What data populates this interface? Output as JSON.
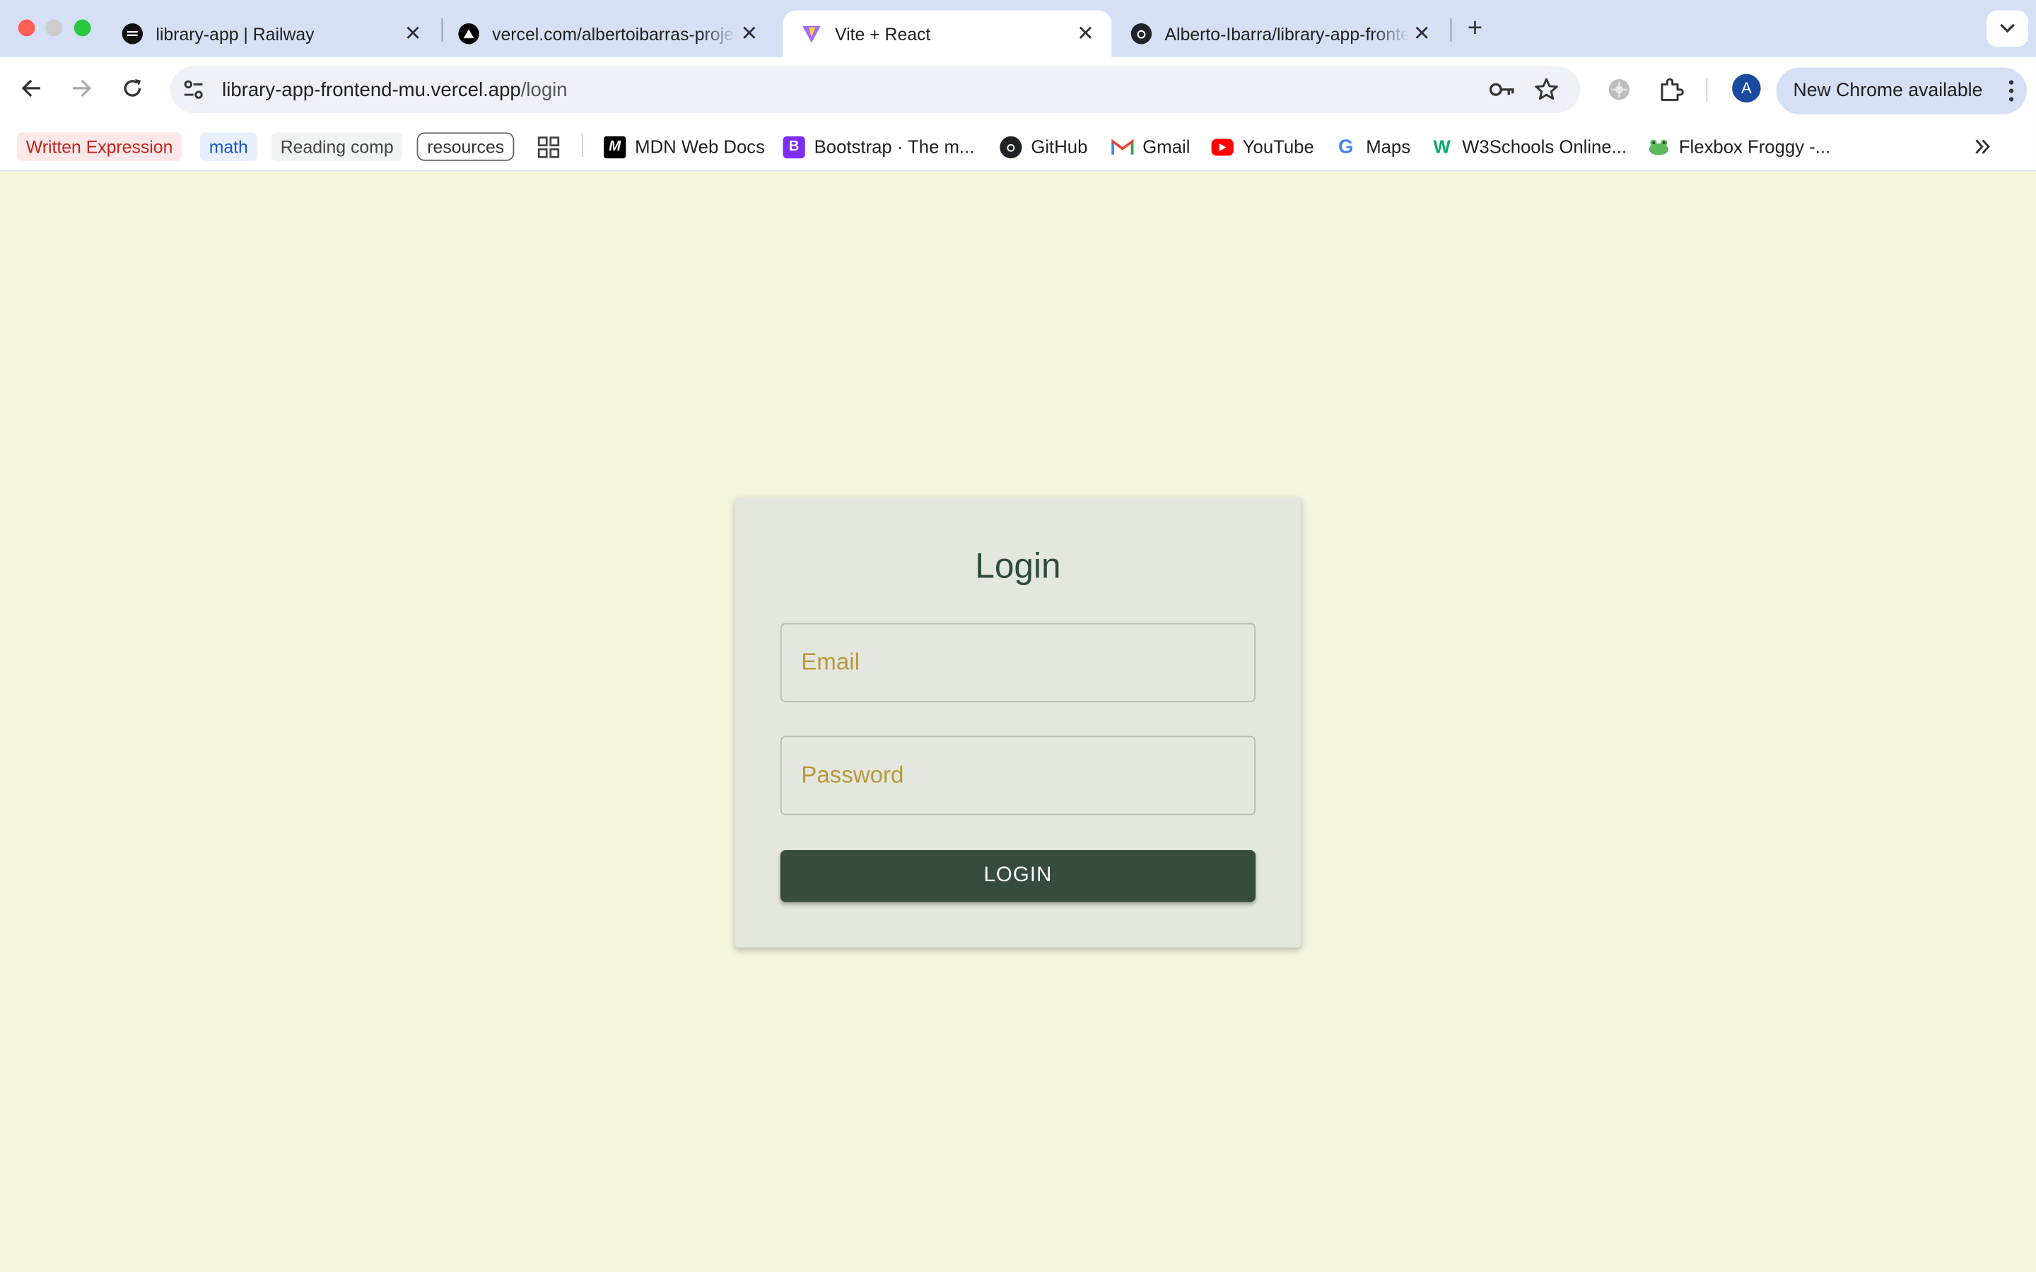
{
  "tabs": [
    {
      "title": "library-app | Railway",
      "icon": "railway-icon"
    },
    {
      "title": "vercel.com/albertoibarras-projects",
      "icon": "vercel-icon"
    },
    {
      "title": "Vite + React",
      "icon": "vite-icon",
      "active": true
    },
    {
      "title": "Alberto-Ibarra/library-app-frontend",
      "icon": "github-icon"
    }
  ],
  "toolbar": {
    "url_host": "library-app-frontend-mu.vercel.app",
    "url_path": "/login",
    "avatar_letter": "A",
    "update_label": "New Chrome available"
  },
  "bookmarks": {
    "chips": [
      "Written Expression",
      "math",
      "Reading comp",
      "resources"
    ],
    "links": [
      {
        "label": "MDN Web Docs",
        "icon": "mdn-icon"
      },
      {
        "label": "Bootstrap · The m...",
        "icon": "bootstrap-icon"
      },
      {
        "label": "GitHub",
        "icon": "github-icon"
      },
      {
        "label": "Gmail",
        "icon": "gmail-icon"
      },
      {
        "label": "YouTube",
        "icon": "youtube-icon"
      },
      {
        "label": "Maps",
        "icon": "google-icon"
      },
      {
        "label": "W3Schools Online...",
        "icon": "w3schools-icon"
      },
      {
        "label": "Flexbox Froggy -...",
        "icon": "frog-icon"
      }
    ]
  },
  "login": {
    "title": "Login",
    "email_placeholder": "Email",
    "password_placeholder": "Password",
    "button_label": "LOGIN"
  },
  "colors": {
    "page_bg": "#f4f4df",
    "card_bg": "#e4e6e0",
    "button_bg": "#354c3f",
    "title_color": "#2d4a3e",
    "placeholder_color": "#b59a3a"
  }
}
